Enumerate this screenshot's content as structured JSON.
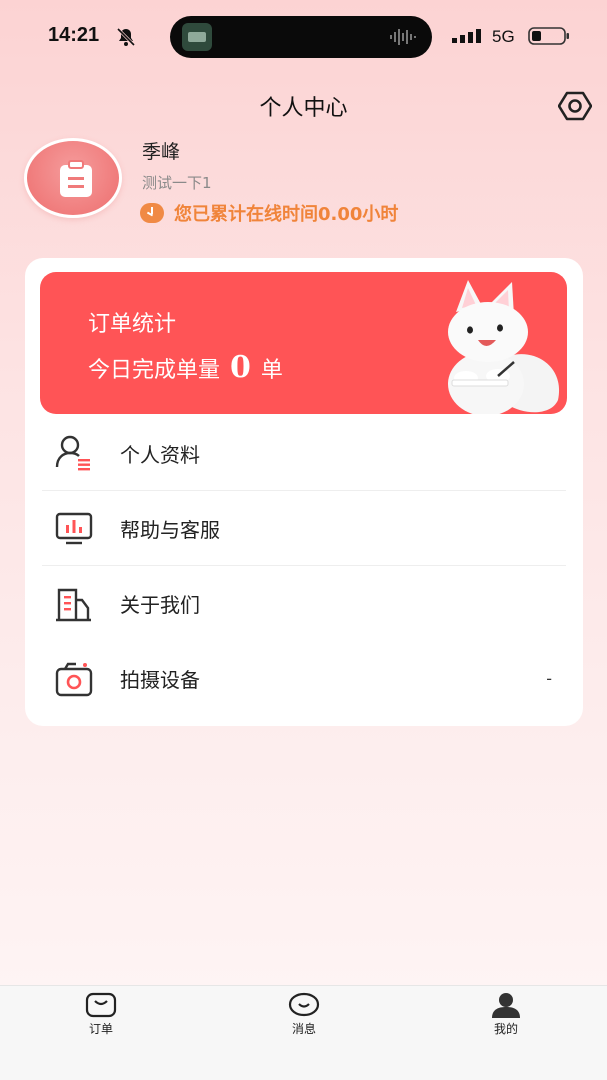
{
  "status_bar": {
    "time": "14:21",
    "network": "5G"
  },
  "header": {
    "title": "个人中心"
  },
  "profile": {
    "name": "季峰",
    "subtitle": "测试一下1",
    "online_text": "您已累计在线时间0.00小时"
  },
  "order_stats": {
    "title": "订单统计",
    "today_prefix": "今日完成单量",
    "today_count": "0",
    "today_unit": "单"
  },
  "menu": {
    "items": [
      {
        "label": "个人资料",
        "icon": "user-profile-icon"
      },
      {
        "label": "帮助与客服",
        "icon": "monitor-chart-icon"
      },
      {
        "label": "关于我们",
        "icon": "building-icon"
      },
      {
        "label": "拍摄设备",
        "icon": "camera-icon",
        "value": "-"
      }
    ]
  },
  "tabbar": {
    "tabs": [
      {
        "label": "订单",
        "icon": "order-icon"
      },
      {
        "label": "消息",
        "icon": "message-icon"
      },
      {
        "label": "我的",
        "icon": "person-icon"
      }
    ]
  },
  "colors": {
    "accent": "#ff5456",
    "online_text": "#f0843a",
    "background_top": "#fcd3d3"
  }
}
